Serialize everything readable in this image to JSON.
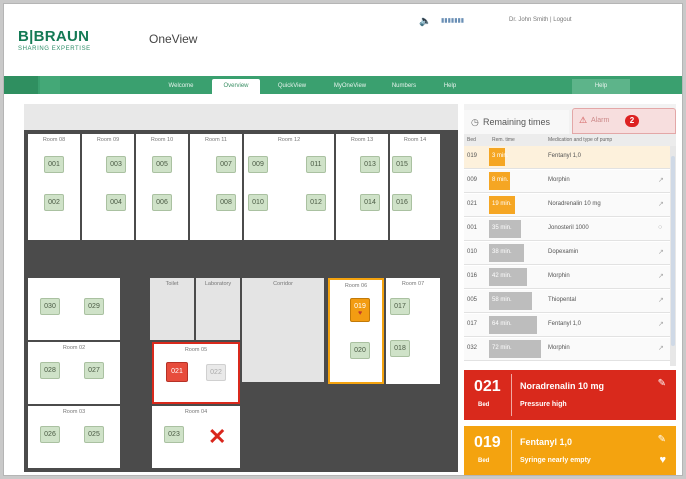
{
  "header": {
    "brand": "B|BRAUN",
    "brand_sub": "SHARING EXPERTISE",
    "app_title": "OneView",
    "volume_value": "▮▮▮▮▮▮▮",
    "user_info": "Dr. John Smith | Logout"
  },
  "nav": {
    "tabs": [
      "Welcome",
      "Overview",
      "QuickView",
      "MyOneView",
      "Numbers",
      "Help"
    ],
    "active_tab": "Overview",
    "help_box": "Help"
  },
  "floor": {
    "rooms_top": [
      {
        "label": "Room 08",
        "beds": [
          "001",
          "002"
        ]
      },
      {
        "label": "Room 09",
        "beds": [
          "003",
          "004"
        ]
      },
      {
        "label": "Room 10",
        "beds": [
          "005",
          "006"
        ]
      },
      {
        "label": "Room 11",
        "beds": [
          "007",
          "008"
        ]
      },
      {
        "label": "Room 12",
        "beds": [
          "009",
          "011",
          "010",
          "012"
        ]
      },
      {
        "label": "Room 13",
        "beds": [
          "013",
          "014"
        ]
      },
      {
        "label": "Room 14",
        "beds": [
          "015",
          "016"
        ]
      }
    ],
    "room_left_top": {
      "beds": [
        "030",
        "029"
      ]
    },
    "room_02": {
      "label": "Room 02",
      "beds": [
        "028",
        "027"
      ]
    },
    "room_03": {
      "label": "Room 03",
      "beds": [
        "026",
        "025"
      ]
    },
    "room_05": {
      "label": "Room 05",
      "beds": [
        "021",
        "022"
      ]
    },
    "room_04": {
      "label": "Room 04",
      "beds": [
        "023"
      ]
    },
    "corridor_labels": [
      "Toilet",
      "Laboratory",
      "Corridor"
    ],
    "room_06": {
      "label": "Room 06",
      "beds": [
        "019",
        "020"
      ]
    },
    "room_07": {
      "label": "Room 07",
      "beds": [
        "017",
        "018"
      ]
    }
  },
  "panel": {
    "tab_remaining": "Remaining times",
    "tab_alarm": "Alarm",
    "alarm_count": "2",
    "col_bed": "Bed",
    "col_time": "Rem. time",
    "col_med": "Medication and type of pump",
    "rows": [
      {
        "bed": "019",
        "time": "3 min.",
        "med": "Fentanyl 1,0",
        "tool": "",
        "fill": 0.28,
        "color": "orange",
        "hl": true
      },
      {
        "bed": "009",
        "time": "8 min.",
        "med": "Morphin",
        "tool": "↗",
        "fill": 0.36,
        "color": "orange",
        "hl": false
      },
      {
        "bed": "021",
        "time": "19 min.",
        "med": "Noradrenalin 10 mg",
        "tool": "↗",
        "fill": 0.45,
        "color": "orange",
        "hl": false
      },
      {
        "bed": "001",
        "time": "35 min.",
        "med": "Jonosteril 1000",
        "tool": "○",
        "fill": 0.55,
        "color": "grey",
        "hl": false
      },
      {
        "bed": "010",
        "time": "38 min.",
        "med": "Dopexamin",
        "tool": "↗",
        "fill": 0.6,
        "color": "grey",
        "hl": false
      },
      {
        "bed": "016",
        "time": "42 min.",
        "med": "Morphin",
        "tool": "↗",
        "fill": 0.66,
        "color": "grey",
        "hl": false
      },
      {
        "bed": "005",
        "time": "58 min.",
        "med": "Thiopental",
        "tool": "↗",
        "fill": 0.74,
        "color": "grey",
        "hl": false
      },
      {
        "bed": "017",
        "time": "64 min.",
        "med": "Fentanyl 1,0",
        "tool": "↗",
        "fill": 0.82,
        "color": "grey",
        "hl": false
      },
      {
        "bed": "032",
        "time": "72 min.",
        "med": "Morphin",
        "tool": "↗",
        "fill": 0.9,
        "color": "grey",
        "hl": false
      }
    ]
  },
  "alerts": [
    {
      "bed": "021",
      "bed_label": "Bed",
      "drug": "Noradrenalin 10 mg",
      "message": "Pressure high"
    },
    {
      "bed": "019",
      "bed_label": "Bed",
      "drug": "Fentanyl 1,0",
      "message": "Syringe nearly empty"
    }
  ],
  "colors": {
    "brand": "#147a55",
    "nav": "#3aa06f",
    "alarm": "#d9291c",
    "warning": "#f4a30f"
  }
}
